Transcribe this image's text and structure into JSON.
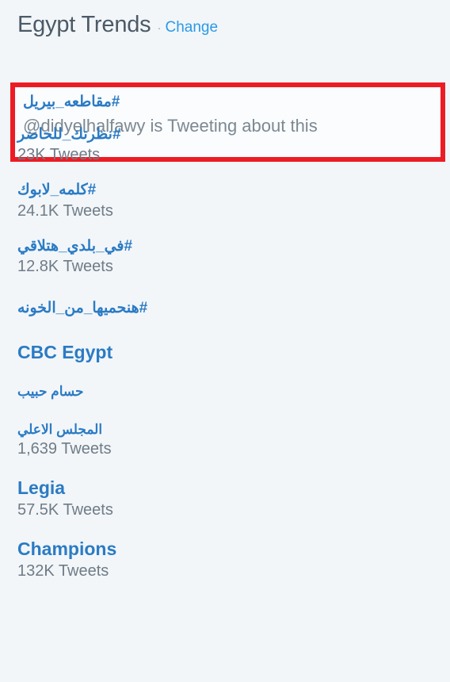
{
  "header": {
    "title": "Egypt Trends",
    "separator": "·",
    "change_label": "Change"
  },
  "highlight": {
    "border_color": "#ed1c24",
    "name": "#مقاطعه_بيريل",
    "subtitle": "@didyelhalfawy is Tweeting about this"
  },
  "colors": {
    "background": "#f2f6f9",
    "link_blue": "#2b7bc4",
    "change_blue": "#2b9ae6",
    "title_gray": "#4c5a66",
    "meta_gray": "#6f7c87",
    "highlight_red": "#ed1c24"
  },
  "trends": [
    {
      "name": "#نظرتك_للحاضر",
      "meta": "23K Tweets",
      "script": "arabic-hashtag"
    },
    {
      "name": "#كلمه_لابوك",
      "meta": "24.1K Tweets",
      "script": "arabic-hashtag"
    },
    {
      "name": "#في_بلدي_هتلاقي",
      "meta": "12.8K Tweets",
      "script": "arabic-hashtag"
    },
    {
      "name": "#هنحميها_من_الخونه",
      "meta": "",
      "script": "arabic-hashtag"
    },
    {
      "name": "CBC Egypt",
      "meta": "",
      "script": "latin"
    },
    {
      "name": "حسام حبيب",
      "meta": "",
      "script": "arabic-plain"
    },
    {
      "name": "المجلس الاعلي",
      "meta": "1,639 Tweets",
      "script": "arabic-plain"
    },
    {
      "name": "Legia",
      "meta": "57.5K Tweets",
      "script": "latin"
    },
    {
      "name": "Champions",
      "meta": "132K Tweets",
      "script": "latin"
    }
  ]
}
